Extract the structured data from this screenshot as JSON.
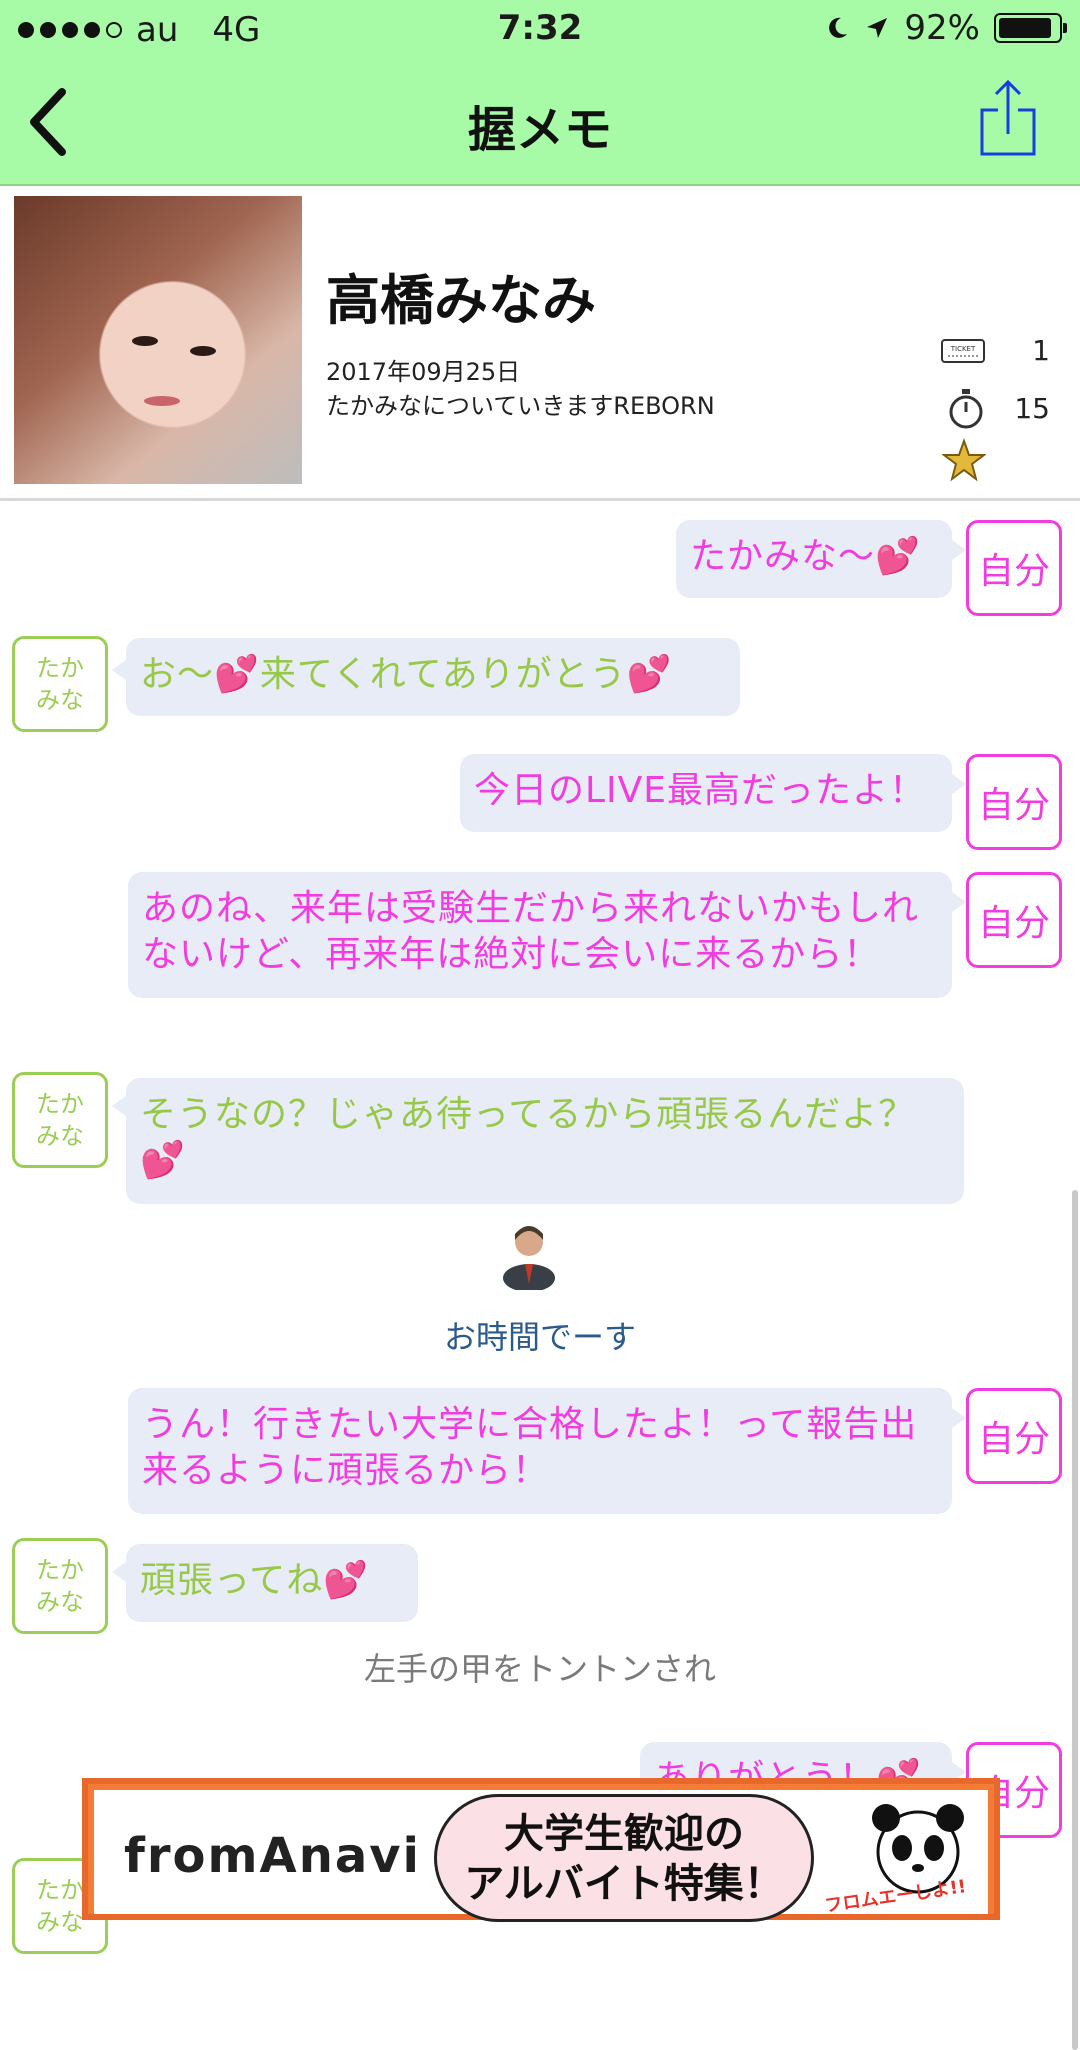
{
  "status_bar": {
    "carrier": "au",
    "network": "4G",
    "time": "7:32",
    "battery": "92%",
    "battery_level": 0.92
  },
  "navbar": {
    "title": "握メモ"
  },
  "profile": {
    "name": "高橋みなみ",
    "date": "2017年09月25日",
    "event": "たかみなについていきますREBORN",
    "tickets": "1",
    "seconds": "15"
  },
  "tags": {
    "self": "自分",
    "other_line1": "たか",
    "other_line2": "みな"
  },
  "messages": [
    {
      "from": "self",
      "text": "たかみな〜",
      "heart": "💕"
    },
    {
      "from": "other",
      "text": "お〜",
      "heart1": "💕",
      "text2": "来てくれてありがとう",
      "heart2": "💕"
    },
    {
      "from": "self",
      "text": "今日のLIVE最高だったよ！"
    },
    {
      "from": "self",
      "line1": "あのね、来年は受験生だから来れないかもしれ",
      "line2": "ないけど、再来年は絶対に会いに来るから！"
    },
    {
      "from": "other",
      "line1": "そうなの？じゃあ待ってるから頑張るんだよ？",
      "heart": "💕"
    },
    {
      "from": "self",
      "line1": "うん！行きたい大学に合格したよ！って報告出",
      "line2": "来るように頑張るから！"
    },
    {
      "from": "other",
      "text": "頑張ってね",
      "heart": "💕"
    },
    {
      "from": "self",
      "text": "ありがとう！",
      "heart": "💕"
    }
  ],
  "notices": {
    "time_up": "お時間でーす",
    "action": "左手の甲をトントンされ"
  },
  "ad": {
    "brand": "fromAnavi",
    "line1": "大学生歓迎の",
    "line2": "アルバイト特集！",
    "mascot_text": "フロムエーしよ!!"
  },
  "colors": {
    "header_bg": "#a8fba6",
    "self_text": "#f13ce0",
    "other_text": "#98c84a",
    "bubble_bg": "#e8ecf7",
    "notice_text": "#2b5a8c"
  }
}
